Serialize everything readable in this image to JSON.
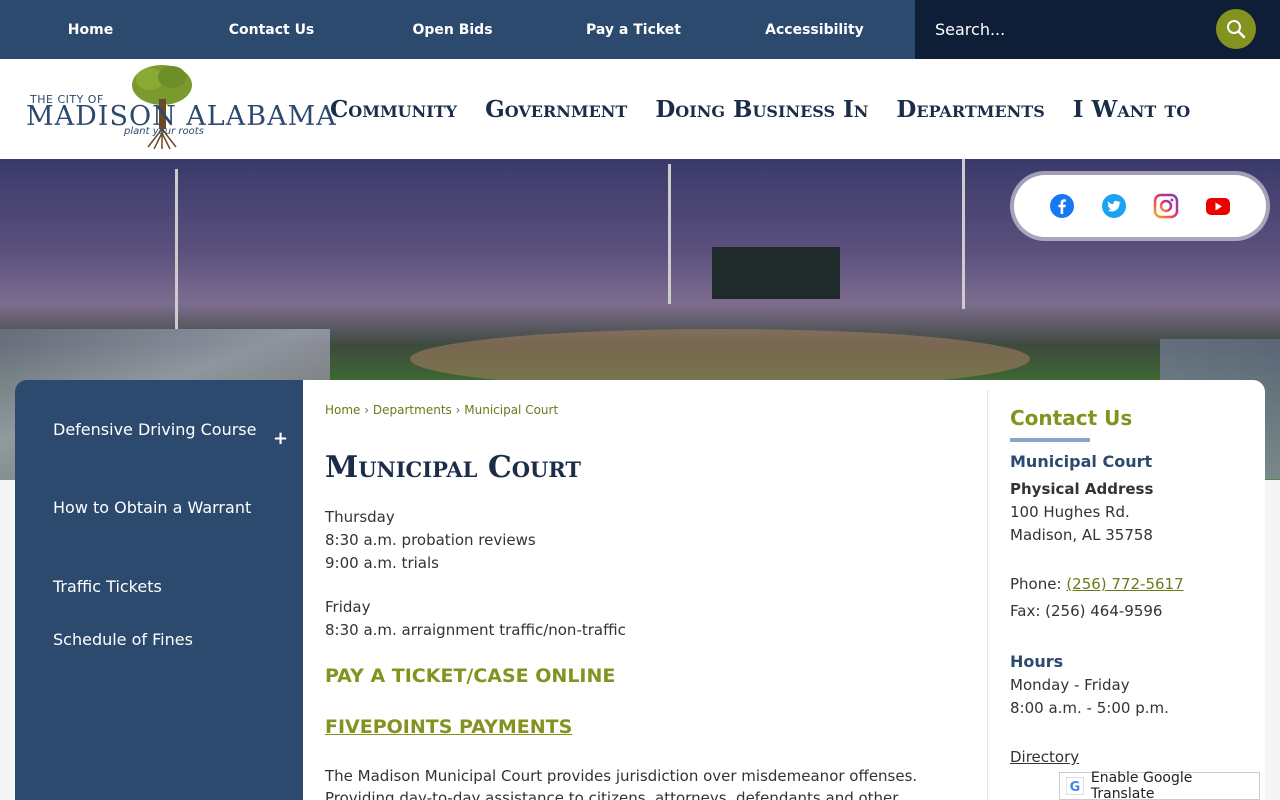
{
  "topnav": {
    "items": [
      "Home",
      "Contact Us",
      "Open Bids",
      "Pay a Ticket",
      "Accessibility"
    ]
  },
  "search": {
    "placeholder": "Search..."
  },
  "logo": {
    "city_of": "THE CITY OF",
    "name": "MADISON ALABAMA",
    "tagline": "plant your roots"
  },
  "mainnav": {
    "items": [
      "Community",
      "Government",
      "Doing Business In",
      "Departments",
      "I Want to"
    ]
  },
  "social": {
    "icons": [
      "facebook-icon",
      "twitter-icon",
      "instagram-icon",
      "youtube-icon"
    ]
  },
  "sidebar": {
    "items": [
      "Defensive Driving Course",
      "How to Obtain a Warrant",
      "Traffic Tickets",
      "Schedule of Fines"
    ],
    "expand": "+"
  },
  "breadcrumb": {
    "items": [
      "Home",
      "Departments",
      "Municipal Court"
    ],
    "separator": "›"
  },
  "page": {
    "title": "Municipal Court",
    "schedule": [
      {
        "day": "Thursday",
        "lines": [
          "8:30 a.m. probation reviews",
          "9:00 a.m. trials"
        ]
      },
      {
        "day": "Friday",
        "lines": [
          "8:30 a.m. arraignment traffic/non-traffic"
        ]
      }
    ],
    "pay_link": "PAY A TICKET/CASE ONLINE",
    "fivepoints_link": "FIVEPOINTS PAYMENTS",
    "description": "The Madison Municipal Court provides jurisdiction over misdemeanor offenses. Providing day-to-day assistance to citizens, attorneys, defendants and other"
  },
  "contact": {
    "heading": "Contact Us",
    "department": "Municipal Court",
    "address_label": "Physical Address",
    "address_line1": "100 Hughes Rd.",
    "address_line2": "Madison, AL 35758",
    "phone_label": "Phone:",
    "phone": "(256) 772-5617",
    "fax": "Fax: (256) 464-9596",
    "hours_heading": "Hours",
    "hours_days": "Monday - Friday",
    "hours_time": "8:00 a.m. - 5:00 p.m.",
    "directory": "Directory"
  },
  "translate": {
    "label": "Enable Google Translate"
  },
  "colors": {
    "navy": "#2c4a6e",
    "olive": "#84921f",
    "dark": "#0e1e36"
  }
}
